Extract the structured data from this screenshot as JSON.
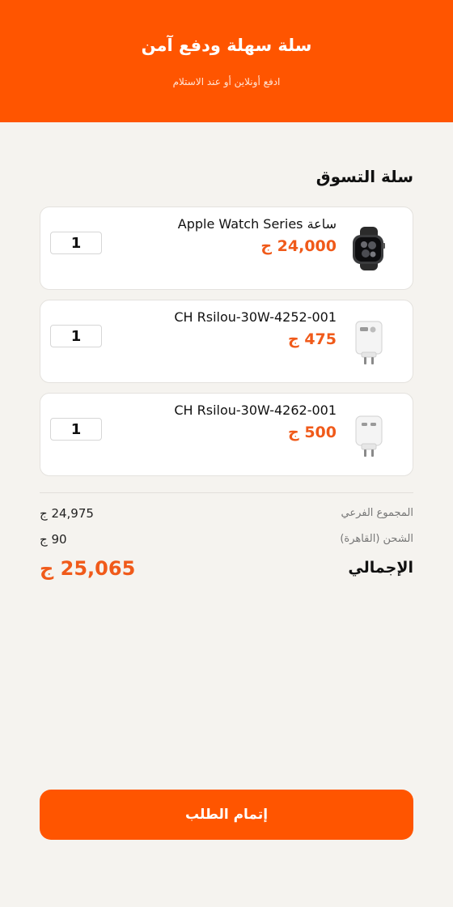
{
  "header": {
    "title": "سلة سهلة ودفع آمن",
    "subtitle": "ادفع أونلاين أو عند الاستلام"
  },
  "cart": {
    "title": "سلة التسوق",
    "items": [
      {
        "name": "ساعة Apple Watch Series",
        "price": "24,000 ج",
        "quantity": "1",
        "icon": "smartwatch-icon"
      },
      {
        "name": "CH Rsilou-30W-4252-001",
        "price": "475 ج",
        "quantity": "1",
        "icon": "charger-icon"
      },
      {
        "name": "CH Rsilou-30W-4262-001",
        "price": "500 ج",
        "quantity": "1",
        "icon": "charger-icon"
      }
    ]
  },
  "summary": {
    "subtotal_label": "المجموع الفرعي",
    "subtotal_value": "24,975 ج",
    "shipping_label": "الشحن (القاهرة)",
    "shipping_value": "90 ج",
    "total_label": "الإجمالي",
    "total_value": "25,065 ج"
  },
  "checkout": {
    "label": "إتمام الطلب"
  },
  "colors": {
    "accent": "#ff5500",
    "price": "#f05a1a",
    "background": "#f5f3ef"
  }
}
